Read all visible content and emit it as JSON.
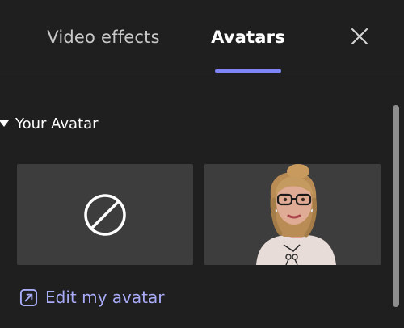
{
  "tabs": {
    "video_effects": "Video effects",
    "avatars": "Avatars"
  },
  "section": {
    "title": "Your Avatar"
  },
  "edit": {
    "label": "Edit my avatar"
  },
  "icons": {
    "close": "close-icon",
    "caret": "caret-down-icon",
    "none": "no-avatar-icon",
    "edit": "open-external-icon"
  },
  "colors": {
    "background": "#1f1f1f",
    "accent": "#7f85f5",
    "link": "#a8abf7",
    "tile": "#3d3d3d"
  }
}
